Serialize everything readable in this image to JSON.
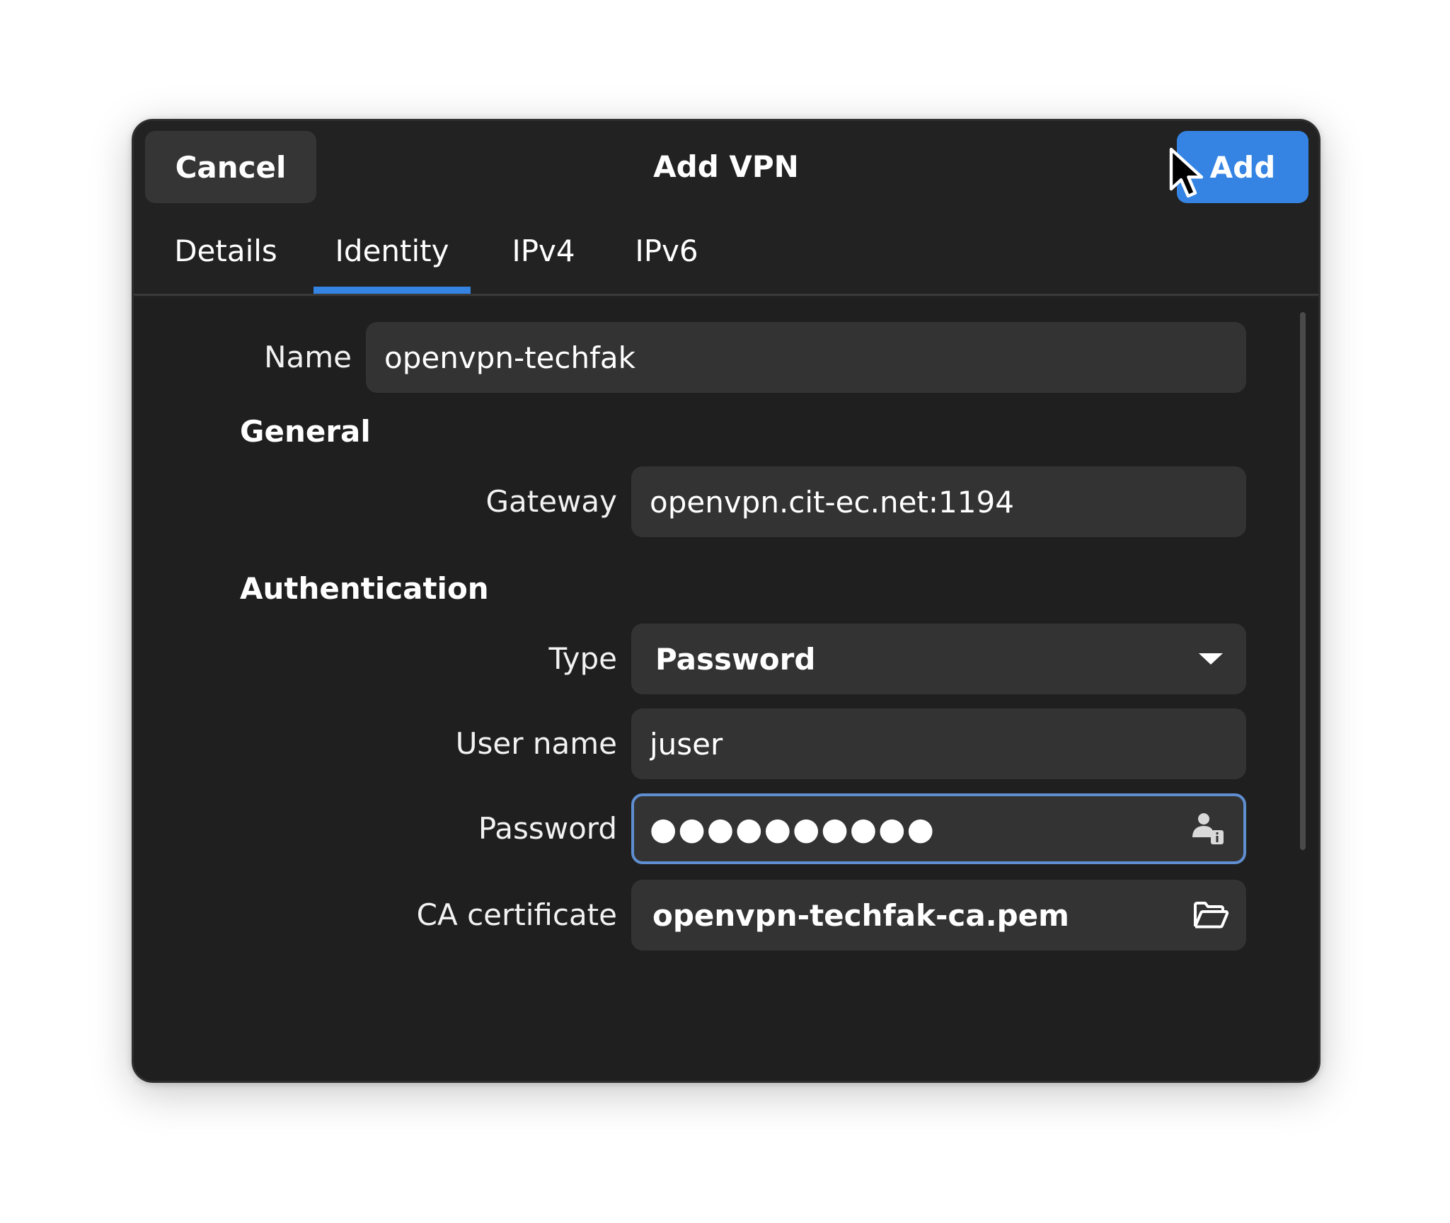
{
  "header": {
    "cancel_label": "Cancel",
    "title": "Add VPN",
    "add_label": "Add"
  },
  "tabs": [
    {
      "label": "Details",
      "active": false
    },
    {
      "label": "Identity",
      "active": true
    },
    {
      "label": "IPv4",
      "active": false
    },
    {
      "label": "IPv6",
      "active": false
    }
  ],
  "form": {
    "name_label": "Name",
    "name_value": "openvpn-techfak",
    "general_heading": "General",
    "gateway_label": "Gateway",
    "gateway_value": "openvpn.cit-ec.net:1194",
    "auth_heading": "Authentication",
    "type_label": "Type",
    "type_value": "Password",
    "username_label": "User name",
    "username_value": "juser",
    "password_label": "Password",
    "password_value": "●●●●●●●●●●",
    "ca_label": "CA certificate",
    "ca_value": "openvpn-techfak-ca.pem"
  },
  "colors": {
    "accent": "#3584e4",
    "background": "#1f1f1f",
    "field": "#333333",
    "focus_border": "#5f8ed1"
  },
  "icons": {
    "type_dropdown": "pan-down-icon",
    "password_storage": "user-info-icon",
    "ca_chooser": "folder-open-icon",
    "cursor": "pointer-cursor-icon"
  }
}
